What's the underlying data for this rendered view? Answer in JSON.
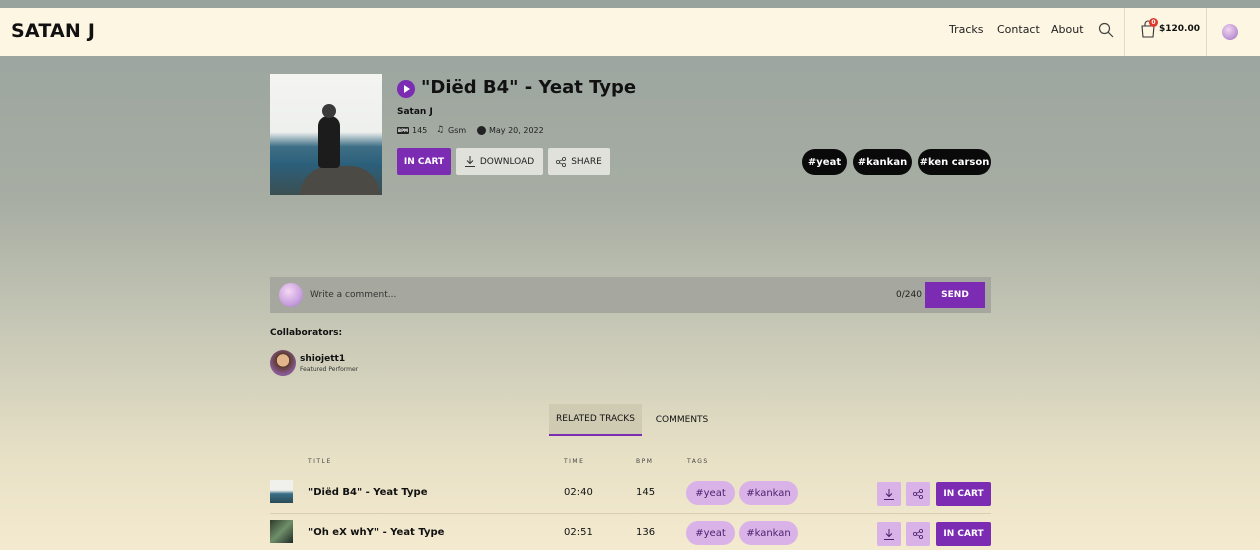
{
  "header": {
    "brand": "SATAN J",
    "nav": [
      "Tracks",
      "Contact",
      "About"
    ],
    "cart": {
      "badge": "0",
      "total": "$120.00"
    }
  },
  "track": {
    "title": "\"Diëd B4\" - Yeat Type",
    "artist": "Satan J",
    "bpm": "145",
    "key": "Gsm",
    "date": "May 20, 2022",
    "buttons": {
      "in_cart": "IN CART",
      "download": "DOWNLOAD",
      "share": "SHARE"
    },
    "tags": [
      "#yeat",
      "#kankan",
      "#ken carson"
    ]
  },
  "comment": {
    "placeholder": "Write a comment...",
    "count": "0/240",
    "send": "SEND"
  },
  "collaborators": {
    "label": "Collaborators:",
    "items": [
      {
        "name": "shiojett1",
        "role": "Featured Performer"
      }
    ]
  },
  "tabs": [
    "RELATED TRACKS",
    "COMMENTS"
  ],
  "table": {
    "headers": {
      "title": "TITLE",
      "time": "TIME",
      "bpm": "BPM",
      "tags": "TAGS"
    },
    "rows": [
      {
        "title": "\"Diëd B4\" - Yeat Type",
        "time": "02:40",
        "bpm": "145",
        "tags": [
          "#yeat",
          "#kankan"
        ],
        "action": "IN CART"
      },
      {
        "title": "\"Oh eX whY\" - Yeat Type",
        "time": "02:51",
        "bpm": "136",
        "tags": [
          "#yeat",
          "#kankan"
        ],
        "action": "IN CART"
      }
    ]
  },
  "colors": {
    "accent": "#7b2cb3",
    "tag_bg": "#d9b3e8",
    "header_bg": "#fdf6e3"
  },
  "icons": [
    "play-icon",
    "bpm-icon",
    "music-note-icon",
    "clock-icon",
    "download-icon",
    "share-icon",
    "search-icon",
    "shopping-bag-icon"
  ]
}
